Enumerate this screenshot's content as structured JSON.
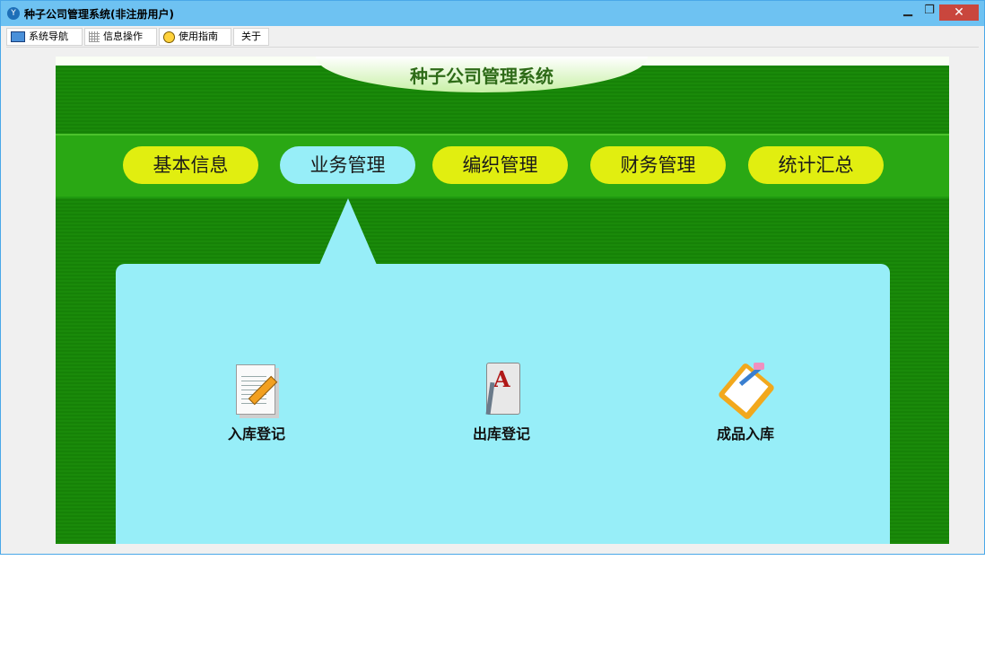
{
  "window": {
    "title": "种子公司管理系统(非注册用户)",
    "app_icon": "app-logo-icon",
    "minimize_glyph": "▁",
    "restore_glyph": "❐",
    "close_glyph": "✕"
  },
  "menu": {
    "items": [
      {
        "label": "系统导航",
        "icon": "monitor-icon"
      },
      {
        "label": "信息操作",
        "icon": "grid-icon"
      },
      {
        "label": "使用指南",
        "icon": "clock-icon"
      },
      {
        "label": "关于"
      }
    ]
  },
  "banner": {
    "title": "种子公司管理系统"
  },
  "nav": {
    "tabs": [
      {
        "label": "基本信息",
        "active": false
      },
      {
        "label": "业务管理",
        "active": true
      },
      {
        "label": "编织管理",
        "active": false
      },
      {
        "label": "财务管理",
        "active": false
      },
      {
        "label": "统计汇总",
        "active": false
      }
    ]
  },
  "functions": [
    {
      "label": "入库登记",
      "icon": "document-pencil-icon"
    },
    {
      "label": "出库登记",
      "icon": "book-letter-a-icon"
    },
    {
      "label": "成品入库",
      "icon": "clipboard-pencil-icon"
    }
  ],
  "colors": {
    "titlebar": "#6ec2f2",
    "close_button": "#c9463d",
    "panel_green": "#1a8a0a",
    "pill_yellow": "#e1ee10",
    "pill_active": "#97eef8",
    "content_bg": "#97eef8"
  }
}
